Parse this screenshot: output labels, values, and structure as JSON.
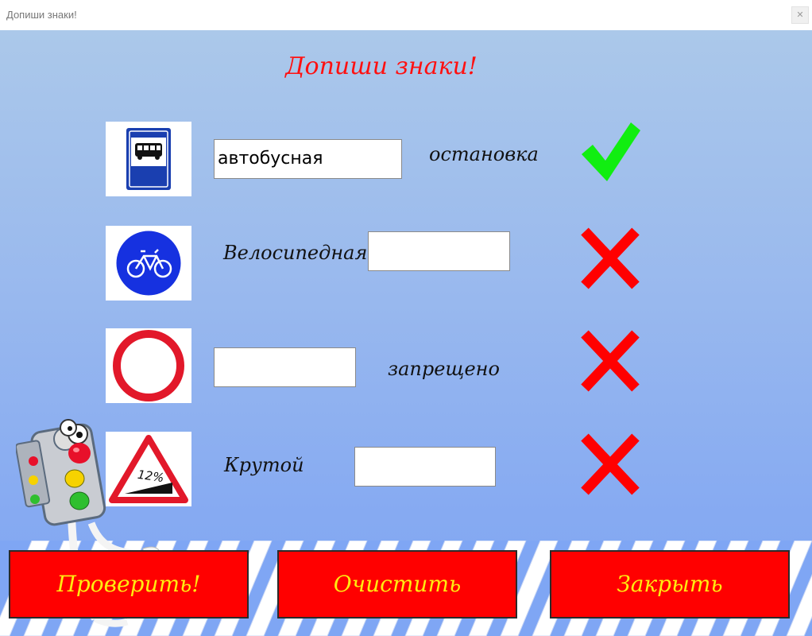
{
  "window": {
    "title": "Допиши знаки!",
    "close_glyph": "✕"
  },
  "heading": "Допиши знаки!",
  "rows": [
    {
      "sign_icon": "bus-stop-sign-icon",
      "input_value": "автобусная",
      "word": "остановка",
      "status": "correct",
      "status_icon": "check-icon"
    },
    {
      "sign_icon": "bicycle-path-sign-icon",
      "input_value": "",
      "word": "Велосипедная",
      "status": "incorrect",
      "status_icon": "cross-icon"
    },
    {
      "sign_icon": "no-entry-circle-sign-icon",
      "input_value": "",
      "word": "запрещено",
      "status": "incorrect",
      "status_icon": "cross-icon"
    },
    {
      "sign_icon": "steep-descent-sign-icon",
      "sign_text": "12%",
      "input_value": "",
      "word": "Крутой",
      "status": "incorrect",
      "status_icon": "cross-icon"
    }
  ],
  "buttons": {
    "check": "Проверить!",
    "clear": "Очистить",
    "close": "Закрыть"
  },
  "colors": {
    "button_bg": "#ff0000",
    "button_text": "#ffeb10",
    "heading": "#ff1010",
    "check": "#11ee11",
    "cross": "#ff0000"
  }
}
